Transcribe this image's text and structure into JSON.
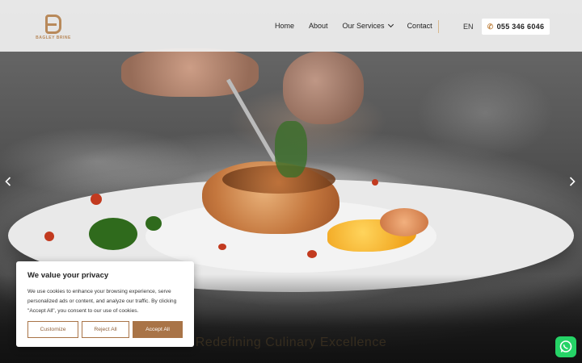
{
  "brand": {
    "logo_text": "BAGLEY BRINE",
    "accent": "#b8895a"
  },
  "nav": {
    "items": [
      {
        "label": "Home"
      },
      {
        "label": "About"
      },
      {
        "label": "Our Services",
        "has_dropdown": true
      },
      {
        "label": "Contact"
      }
    ],
    "language": "EN",
    "phone": "055 346 6046",
    "phone_icon": "phone-icon"
  },
  "hero": {
    "tagline": "Redefining Culinary Excellence",
    "prev_icon": "chevron-left-icon",
    "next_icon": "chevron-right-icon"
  },
  "cookie_banner": {
    "title": "We value your privacy",
    "text": "We use cookies to enhance your browsing experience, serve personalized ads or content, and analyze our traffic. By clicking \"Accept All\", you consent to our use of cookies.",
    "buttons": {
      "customize": "Customize",
      "reject": "Reject All",
      "accept": "Accept All"
    },
    "button_color": "#a97447"
  },
  "floating": {
    "whatsapp_icon": "whatsapp-icon",
    "whatsapp_color": "#25d366"
  }
}
